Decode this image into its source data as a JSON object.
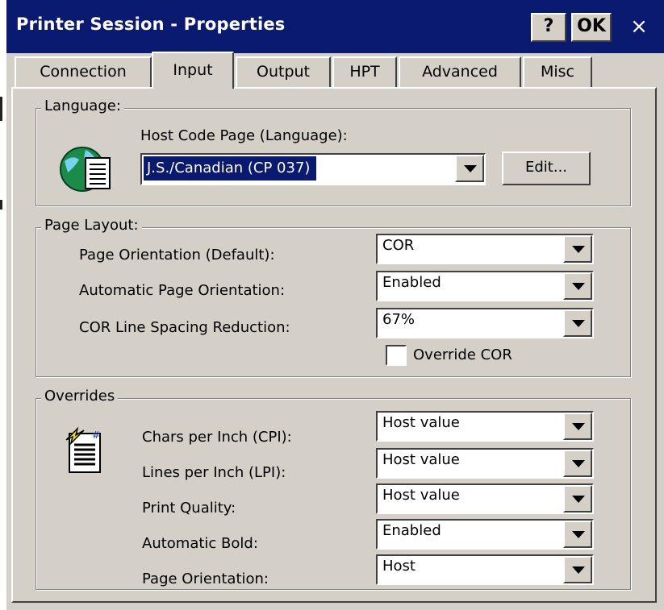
{
  "window": {
    "title": "Printer Session - Properties",
    "help_label": "?",
    "ok_label": "OK",
    "close_label": "×"
  },
  "tabs": [
    {
      "label": "Connection",
      "active": false
    },
    {
      "label": "Input",
      "active": true
    },
    {
      "label": "Output",
      "active": false
    },
    {
      "label": "HPT",
      "active": false
    },
    {
      "label": "Advanced",
      "active": false
    },
    {
      "label": "Misc",
      "active": false
    }
  ],
  "language": {
    "group_label": "Language:",
    "host_code_page_label": "Host Code Page (Language):",
    "host_code_page_value": "J.S./Canadian (CP 037)",
    "edit_label": "Edit...",
    "icon": "globe-document-icon"
  },
  "page_layout": {
    "group_label": "Page Layout:",
    "orientation_label": "Page Orientation (Default):",
    "orientation_value": "COR",
    "auto_orientation_label": "Automatic Page Orientation:",
    "auto_orientation_value": "Enabled",
    "cor_spacing_label": "COR Line Spacing Reduction:",
    "cor_spacing_value": "67%",
    "override_cor_label": "Override COR",
    "override_cor_checked": false
  },
  "overrides": {
    "group_label": "Overrides",
    "icon": "printer-settings-icon",
    "cpi_label": "Chars per Inch (CPI):",
    "cpi_value": "Host value",
    "lpi_label": "Lines per Inch (LPI):",
    "lpi_value": "Host value",
    "print_quality_label": "Print Quality:",
    "print_quality_value": "Host value",
    "auto_bold_label": "Automatic Bold:",
    "auto_bold_value": "Enabled",
    "page_orientation_label": "Page Orientation:",
    "page_orientation_value": "Host"
  },
  "colors": {
    "titlebar": "#0a1a70",
    "face": "#d4d0c8",
    "selection": "#0a1a70"
  }
}
